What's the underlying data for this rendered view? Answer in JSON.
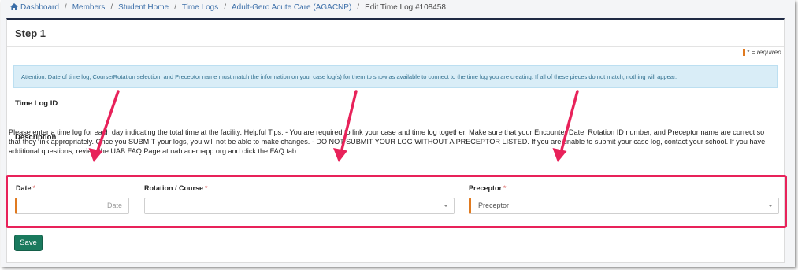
{
  "breadcrumb": {
    "items": [
      "Dashboard",
      "Members",
      "Student Home",
      "Time Logs",
      "Adult-Gero Acute Care (AGACNP)"
    ],
    "current": "Edit Time Log #108458"
  },
  "card": {
    "step_title": "Step 1",
    "required_note": "* = required",
    "alert_text": "Attention: Date of time log, Course/Rotation selection, and Preceptor name must match the information on your case log(s) for them to show as available to connect to the time log you are creating. If all of these pieces do not match, nothing will appear.",
    "time_log_id_label": "Time Log ID",
    "description_label": "Description",
    "description_text": "Please enter a time log for each day indicating the total time at the facility. Helpful Tips: - You are required to link your case and time log together. Make sure that your Encounter Date, Rotation ID number, and Preceptor name are correct so that they link appropriately. Once you SUBMIT your logs, you will not be able to make changes. - DO NOT SUBMIT YOUR LOG WITHOUT A PRECEPTOR LISTED. If you are unable to submit your case log, contact your school. If you have additional questions, review the UAB FAQ Page at uab.acemapp.org and click the FAQ tab."
  },
  "form": {
    "date_label": "Date",
    "date_placeholder": "Date",
    "rotation_label": "Rotation / Course",
    "rotation_value": "",
    "preceptor_label": "Preceptor",
    "preceptor_value": "Preceptor",
    "required_star": "*"
  },
  "actions": {
    "save_label": "Save"
  },
  "colors": {
    "annotation": "#e8225a",
    "primary_button": "#1a7a5e",
    "required_marker": "#e07a20",
    "alert_bg": "#d9edf7",
    "header_border": "#1f2a44"
  },
  "icons": [
    "home-icon",
    "chevron-down-icon"
  ]
}
